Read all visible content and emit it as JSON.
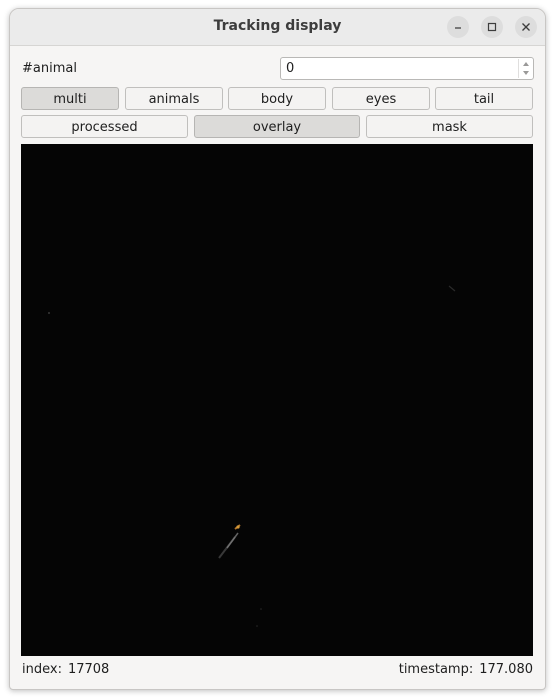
{
  "window": {
    "title": "Tracking display"
  },
  "animal_selector": {
    "label": "#animal",
    "value": "0"
  },
  "view_mode_buttons": [
    {
      "label": "multi",
      "active": true
    },
    {
      "label": "animals",
      "active": false
    },
    {
      "label": "body",
      "active": false
    },
    {
      "label": "eyes",
      "active": false
    },
    {
      "label": "tail",
      "active": false
    }
  ],
  "display_buttons": [
    {
      "label": "processed",
      "active": false
    },
    {
      "label": "overlay",
      "active": true
    },
    {
      "label": "mask",
      "active": false
    }
  ],
  "status": {
    "index_label": "index:",
    "index_value": "17708",
    "timestamp_label": "timestamp:",
    "timestamp_value": "177.080"
  },
  "icons": {
    "minimize": "minimize-icon",
    "maximize": "maximize-icon",
    "close": "close-icon"
  }
}
